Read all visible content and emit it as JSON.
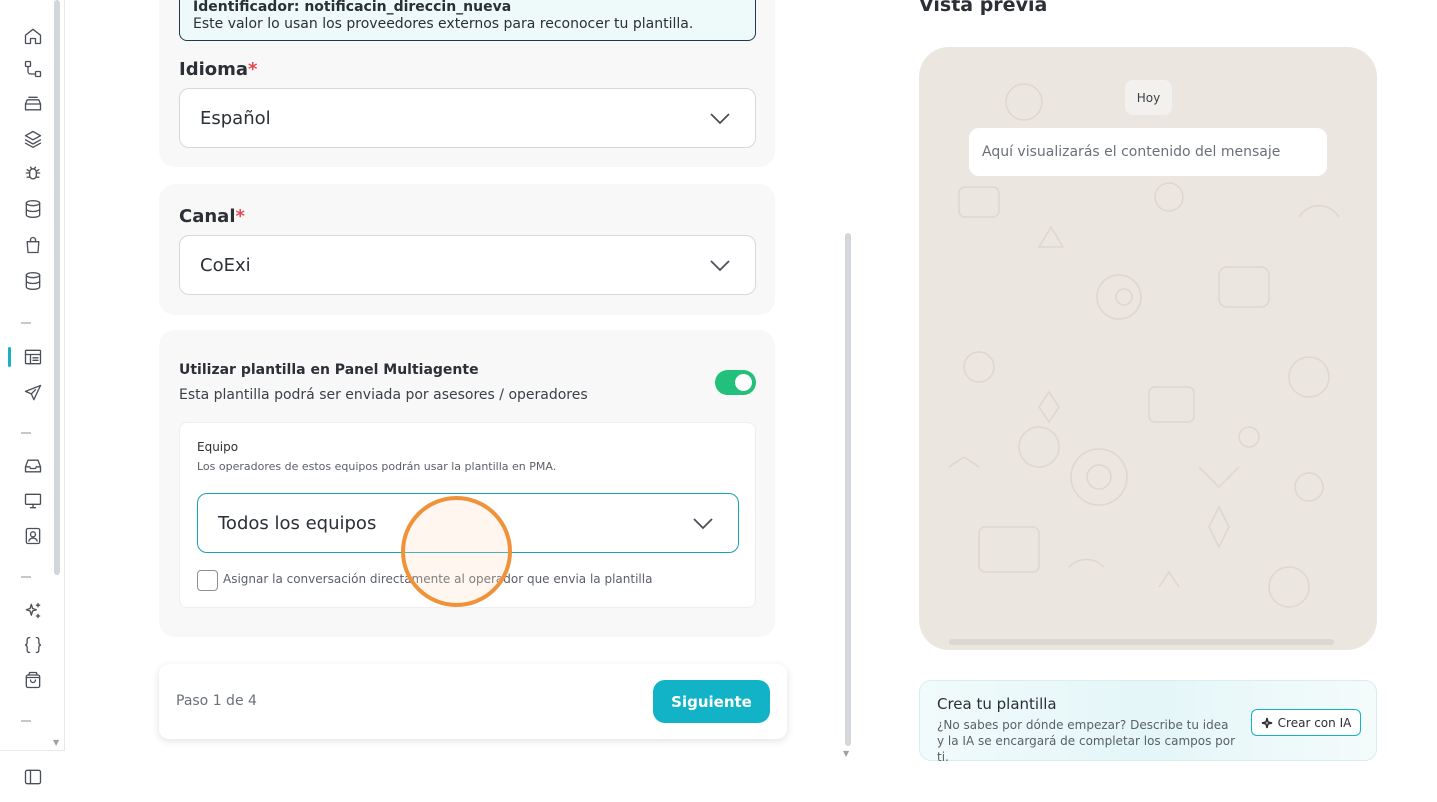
{
  "info_box": {
    "line1": "Identificador: notificacin_direccin_nueva",
    "line2": "Este valor lo usan los proveedores externos para reconocer tu plantilla."
  },
  "language": {
    "label": "Idioma",
    "required_mark": "*",
    "value": "Español"
  },
  "channel": {
    "label": "Canal",
    "required_mark": "*",
    "value": "CoExi"
  },
  "multiagent": {
    "title": "Utilizar plantilla en Panel Multiagente",
    "description": "Esta plantilla podrá ser enviada por asesores / operadores",
    "toggle_on": true,
    "team": {
      "label": "Equipo",
      "description": "Los operadores de estos equipos podrán usar la plantilla en PMA.",
      "value": "Todos los equipos"
    },
    "assign_checkbox": {
      "label": "Asignar la conversación directamente al operador que envia la plantilla",
      "checked": false
    }
  },
  "footer": {
    "step": "Paso 1 de 4",
    "next_label": "Siguiente"
  },
  "preview": {
    "title": "Vista previa",
    "date_chip": "Hoy",
    "message_placeholder": "Aquí visualizarás el contenido del mensaje"
  },
  "ai_card": {
    "title": "Crea tu plantilla",
    "description": "¿No sabes por dónde empezar? Describe tu idea y la IA se encargará de completar los campos por ti.",
    "button_label": "Crear con IA"
  },
  "sidebar": {
    "icons": [
      "home-icon",
      "flow-icon",
      "archive-icon",
      "layers-icon",
      "bug-icon",
      "database-icon",
      "shopping-bag-icon",
      "database-alt-icon",
      "templates-icon",
      "send-icon",
      "inbox-icon",
      "monitor-icon",
      "contact-icon",
      "sparkles-icon",
      "code-braces-icon",
      "shop-bag-icon",
      "panel-toggle-icon"
    ]
  },
  "colors": {
    "accent": "#12b3c7",
    "toggle_on": "#22c07a",
    "required": "#e5484d",
    "preview_bg": "#ebe6df"
  }
}
